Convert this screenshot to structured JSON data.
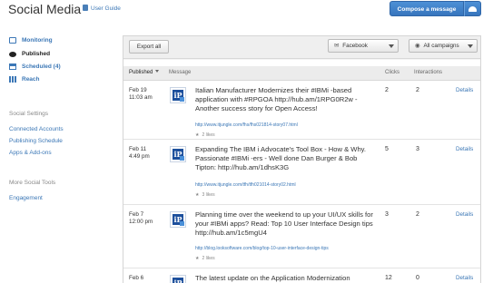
{
  "header": {
    "title": "Social Media",
    "user_guide_label": "User Guide",
    "compose_label": "Compose a message"
  },
  "sidebar": {
    "nav": [
      {
        "label": "Monitoring",
        "icon": "monitor-icon"
      },
      {
        "label": "Published",
        "icon": "speech-bubble-icon"
      },
      {
        "label": "Scheduled (4)",
        "icon": "calendar-icon"
      },
      {
        "label": "Reach",
        "icon": "bar-chart-icon"
      }
    ],
    "settings_heading": "Social Settings",
    "settings_links": [
      "Connected Accounts",
      "Publishing Schedule",
      "Apps & Add-ons"
    ],
    "tools_heading": "More Social Tools",
    "tools_links": [
      "Engagement"
    ]
  },
  "toolbar": {
    "export_label": "Export all",
    "network_select": "Facebook",
    "campaign_select": "All campaigns"
  },
  "table": {
    "columns": {
      "published": "Published",
      "message": "Message",
      "clicks": "Clicks",
      "interactions": "Interactions"
    },
    "details_label": "Details",
    "rows": [
      {
        "date": "Feb 19",
        "time": "11:03 am",
        "message": "Italian Manufacturer Modernizes their #IBMi -based application with #RPGOA http://hub.am/1RPG0R2w - Another success story for Open Access!",
        "link": "http://www.itjungle.com/fhs/fhs021814-story07.html",
        "likes": "2 likes",
        "clicks": "2",
        "interactions": "2"
      },
      {
        "date": "Feb 11",
        "time": "4:49 pm",
        "message": "Expanding The IBM i Advocate's Tool Box - How & Why. Passionate #IBMi -ers - Well done Dan Burger & Bob Tipton: http://hub.am/1dhsK3G",
        "link": "http://www.itjungle.com/tfh/tfh021014-story02.html",
        "likes": "3 likes",
        "clicks": "5",
        "interactions": "3"
      },
      {
        "date": "Feb 7",
        "time": "12:00 pm",
        "message": "Planning time over the weekend to up your UI/UX skills for your #IBMi apps? Read: Top 10 User Interface Design tips http://hub.am/1c5mgU4",
        "link": "http://blog.looksoftware.com/blog/top-10-user-interface-design-tips",
        "likes": "2 likes",
        "clicks": "3",
        "interactions": "2"
      },
      {
        "date": "Feb 6",
        "time": "",
        "message": "The latest update on the Application Modernization Redbook",
        "link": "",
        "likes": "",
        "clicks": "12",
        "interactions": "0"
      }
    ]
  },
  "colors": {
    "accent": "#3b77b6",
    "compose_button": "#3f7fc7",
    "logo": "#1c4f9c"
  }
}
